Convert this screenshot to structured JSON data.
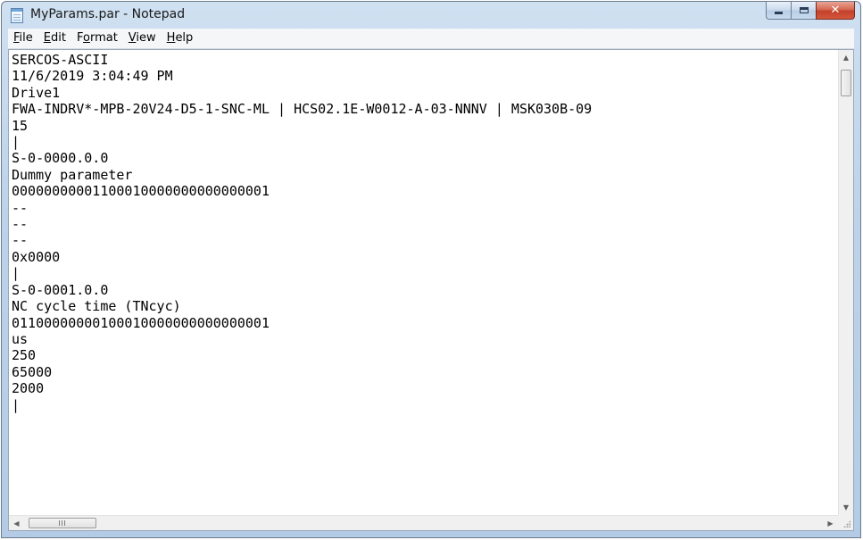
{
  "window": {
    "title": "MyParams.par - Notepad",
    "icon": "notepad-icon",
    "buttons": {
      "minimize_icon": "minimize-icon",
      "maximize_icon": "maximize-icon",
      "close_icon": "close-icon",
      "close_glyph": "✕"
    }
  },
  "menu": {
    "items": [
      {
        "label": "File",
        "mnemonic": "F"
      },
      {
        "label": "Edit",
        "mnemonic": "E"
      },
      {
        "label": "Format",
        "mnemonic": "o"
      },
      {
        "label": "View",
        "mnemonic": "V"
      },
      {
        "label": "Help",
        "mnemonic": "H"
      }
    ]
  },
  "editor": {
    "lines": [
      "SERCOS-ASCII",
      "11/6/2019 3:04:49 PM",
      "Drive1",
      "FWA-INDRV*-MPB-20V24-D5-1-SNC-ML | HCS02.1E-W0012-A-03-NNNV | MSK030B-09",
      "15",
      "|",
      "S-0-0000.0.0",
      "Dummy parameter",
      "00000000001100010000000000000001",
      "--",
      "--",
      "--",
      "0x0000",
      "|",
      "S-0-0001.0.0",
      "NC cycle time (TNcyc)",
      "01100000000100010000000000000001",
      "us",
      "250",
      "65000",
      "2000",
      "|"
    ]
  },
  "scrollbars": {
    "up_arrow": "▲",
    "down_arrow": "▼",
    "left_arrow": "◀",
    "right_arrow": "▶"
  }
}
